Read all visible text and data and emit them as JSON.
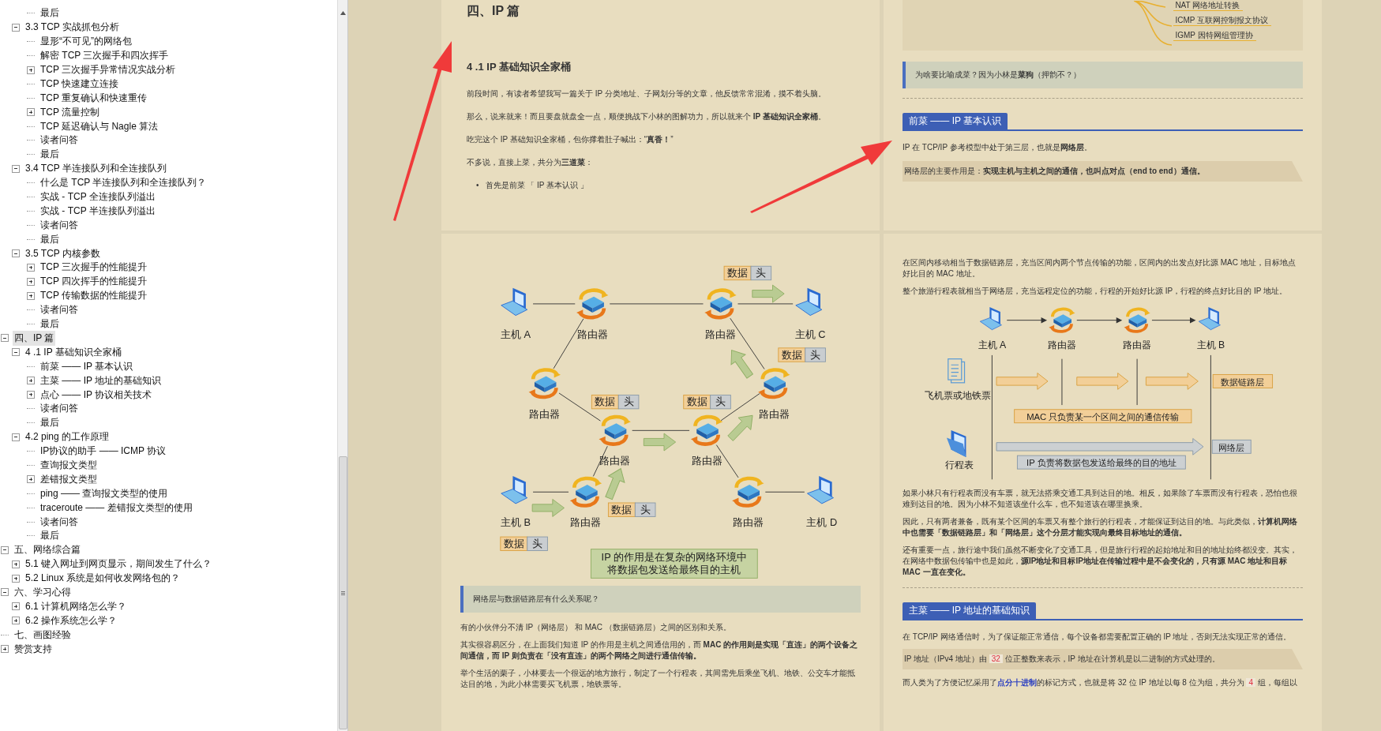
{
  "outline": [
    {
      "children": [
        {
          "children": [
            {
              "label": "最后",
              "selected": false
            }
          ]
        },
        {
          "label": "3.3 TCP 实战抓包分析",
          "expanded": true,
          "selected": false,
          "children": [
            {
              "label": "显形“不可见”的网络包",
              "selected": false
            },
            {
              "label": "解密 TCP 三次握手和四次挥手",
              "selected": false
            },
            {
              "label": "TCP 三次握手异常情况实战分析",
              "expanded": false,
              "selected": false
            },
            {
              "label": "TCP 快速建立连接",
              "selected": false
            },
            {
              "label": "TCP 重复确认和快速重传",
              "selected": false
            },
            {
              "label": "TCP 流量控制",
              "expanded": false,
              "selected": false
            },
            {
              "label": "TCP 延迟确认与 Nagle 算法",
              "selected": false
            },
            {
              "label": "读者问答",
              "selected": false
            },
            {
              "label": "最后",
              "selected": false
            }
          ]
        },
        {
          "label": "3.4 TCP 半连接队列和全连接队列",
          "expanded": true,
          "selected": false,
          "children": [
            {
              "label": "什么是 TCP 半连接队列和全连接队列？",
              "selected": false
            },
            {
              "label": "实战 - TCP 全连接队列溢出",
              "selected": false
            },
            {
              "label": "实战 - TCP 半连接队列溢出",
              "selected": false
            },
            {
              "label": "读者问答",
              "selected": false
            },
            {
              "label": "最后",
              "selected": false
            }
          ]
        },
        {
          "label": "3.5 TCP 内核参数",
          "expanded": true,
          "selected": false,
          "children": [
            {
              "label": "TCP 三次握手的性能提升",
              "expanded": false,
              "selected": false
            },
            {
              "label": "TCP 四次挥手的性能提升",
              "expanded": false,
              "selected": false
            },
            {
              "label": "TCP 传输数据的性能提升",
              "expanded": false,
              "selected": false
            },
            {
              "label": "读者问答",
              "selected": false
            },
            {
              "label": "最后",
              "selected": false
            }
          ]
        }
      ]
    },
    {
      "label": "四、IP 篇",
      "expanded": true,
      "selected": true,
      "children": [
        {
          "label": "4 .1 IP 基础知识全家桶",
          "expanded": true,
          "selected": false,
          "children": [
            {
              "label": "前菜 —— IP 基本认识",
              "selected": false
            },
            {
              "label": "主菜 —— IP 地址的基础知识",
              "expanded": false,
              "selected": false
            },
            {
              "label": "点心 —— IP 协议相关技术",
              "expanded": false,
              "selected": false
            },
            {
              "label": "读者问答",
              "selected": false
            },
            {
              "label": "最后",
              "selected": false
            }
          ]
        },
        {
          "label": "4.2 ping 的工作原理",
          "expanded": true,
          "selected": false,
          "children": [
            {
              "label": "IP协议的助手 —— ICMP 协议",
              "selected": false
            },
            {
              "label": "查询报文类型",
              "selected": false
            },
            {
              "label": "差错报文类型",
              "expanded": false,
              "selected": false
            },
            {
              "label": "ping —— 查询报文类型的使用",
              "selected": false
            },
            {
              "label": "traceroute —— 差错报文类型的使用",
              "selected": false
            },
            {
              "label": "读者问答",
              "selected": false
            },
            {
              "label": "最后",
              "selected": false
            }
          ]
        }
      ]
    },
    {
      "label": "五、网络综合篇",
      "expanded": true,
      "selected": false,
      "children": [
        {
          "label": "5.1 键入网址到网页显示，期间发生了什么？",
          "expanded": false,
          "selected": false
        },
        {
          "label": "5.2 Linux 系统是如何收发网络包的？",
          "expanded": false,
          "selected": false
        }
      ]
    },
    {
      "label": "六、学习心得",
      "expanded": true,
      "selected": false,
      "children": [
        {
          "label": "6.1 计算机网络怎么学？",
          "expanded": false,
          "selected": false
        },
        {
          "label": "6.2 操作系统怎么学？",
          "expanded": false,
          "selected": false
        }
      ]
    },
    {
      "label": "七、画图经验",
      "selected": false
    },
    {
      "label": "赞赏支持",
      "expanded": false,
      "selected": false
    }
  ],
  "pages": {
    "chapter_page": {
      "title": "四、IP 篇",
      "heading": "4 .1 IP 基础知识全家桶",
      "paragraphs": [
        "前段时间，有读者希望我写一篇关于 IP 分类地址、子网划分等的文章，他反馈常常混淆，摸不着头脑。",
        "那么，说来就来！而且要盘就盘全一点，顺便挑战下小林的图解功力，所以就来个 **IP 基础知识全家桶**。",
        "吃完这个 IP 基础知识全家桶，包你撑着肚子喊出：“**真香！**”",
        "不多说，直接上菜，共分为**三道菜**："
      ],
      "bullets": [
        {
          "marker": "•",
          "text": "首先是前菜 「 IP 基本认识 」"
        }
      ]
    },
    "intro_page": {
      "mind_map_branches": [
        "NAT 网络地址转换",
        "ICMP 互联网控制报文协议",
        "IGMP 因特网组管理协"
      ],
      "quote": "为啥要比喻成菜？因为小林是**菜狗**（押韵不？）",
      "section_heading": "前菜 —— IP 基本认识",
      "paragraphs": [
        "IP 在 TCP/IP 参考模型中处于第三层，也就是**网络层**。"
      ],
      "callout": "网络层的主要作用是：**实现主机与主机之间的通信，也叫点对点（end to end）通信。**"
    },
    "network_page": {
      "diagram": {
        "nodes": [
          {
            "kind": "host",
            "label": "主机 A"
          },
          {
            "kind": "router",
            "label": "路由器"
          },
          {
            "kind": "router",
            "label": "路由器"
          },
          {
            "kind": "host",
            "label": "主机 C"
          },
          {
            "kind": "router",
            "label": "路由器"
          },
          {
            "kind": "router",
            "label": "路由器"
          },
          {
            "kind": "router",
            "label": "路由器"
          },
          {
            "kind": "router",
            "label": "路由器"
          },
          {
            "kind": "host",
            "label": "主机 B"
          },
          {
            "kind": "router",
            "label": "路由器"
          },
          {
            "kind": "router",
            "label": "路由器"
          },
          {
            "kind": "host",
            "label": "主机 D"
          }
        ],
        "packets": [
          {
            "data": "数据",
            "header": "头"
          },
          {
            "data": "数据",
            "header": "头"
          },
          {
            "data": "数据",
            "header": "头"
          },
          {
            "data": "数据",
            "header": "头"
          },
          {
            "data": "数据",
            "header": "头"
          },
          {
            "data": "数据",
            "header": "头"
          }
        ],
        "caption": [
          "IP 的作用是在复杂的网络环境中",
          "将数据包发送给最终目的主机"
        ]
      },
      "quote": "网络层与数据链路层有什么关系呢？",
      "paragraphs": [
        "有的小伙伴分不清 IP（网络层） 和 MAC （数据链路层）之间的区别和关系。",
        "其实很容易区分，在上面我们知道 IP 的作用是主机之间通信用的，而 **MAC 的作用则是实现「直连」的两个设备之间通信，而 IP 则负责在「没有直连」的两个网络之间进行通信传输。**",
        "举个生活的栗子，小林要去一个很远的地方旅行，制定了一个行程表，其间需先后乘坐飞机、地铁、公交车才能抵达目的地，为此小林需要买飞机票，地铁票等。"
      ]
    },
    "layers_page": {
      "paragraphs_before": [
        "在区间内移动相当于数据链路层，充当区间内两个节点传输的功能，区间内的出发点好比源 MAC 地址，目标地点好比目的 MAC 地址。",
        "整个旅游行程表就相当于网络层，充当远程定位的功能，行程的开始好比源 IP，行程的终点好比目的 IP 地址。"
      ],
      "diagram": {
        "nodes": [
          {
            "kind": "host",
            "label": "主机 A"
          },
          {
            "kind": "router",
            "label": "路由器"
          },
          {
            "kind": "router",
            "label": "路由器"
          },
          {
            "kind": "host",
            "label": "主机 B"
          }
        ],
        "items": [
          {
            "kind": "ticket",
            "label": "飞机票或地铁票"
          },
          {
            "kind": "itinerary",
            "label": "行程表"
          }
        ],
        "layers": [
          {
            "kind": "data_link",
            "name": "数据链路层",
            "note": "MAC 只负责某一个区间之间的通信传输"
          },
          {
            "kind": "network",
            "name": "网络层",
            "note": "IP 负责将数据包发送给最终的目的地址"
          }
        ]
      },
      "paragraphs_after": [
        "如果小林只有行程表而没有车票，就无法搭乘交通工具到达目的地。相反，如果除了车票而没有行程表，恐怕也很难到达目的地。因为小林不知道该坐什么车，也不知道该在哪里换乘。",
        "因此，只有两者兼备，既有某个区间的车票又有整个旅行的行程表，才能保证到达目的地。与此类似，**计算机网络中也需要「数据链路层」和「网络层」这个分层才能实现向最终目标地址的通信。**",
        "还有重要一点，旅行途中我们虽然不断变化了交通工具，但是旅行行程的起始地址和目的地址始终都没变。其实，在网络中数据包传输中也是如此，**源IP地址和目标IP地址在传输过程中是不会变化的，只有源 MAC 地址和目标 MAC 一直在变化。**"
      ],
      "section_heading": "主菜 —— IP 地址的基础知识",
      "section_paragraph": "在 TCP/IP 网络通信时，为了保证能正常通信，每个设备都需要配置正确的 IP 地址，否则无法实现正常的通信。",
      "callout_parts": [
        {
          "text": "IP 地址（IPv4 地址）由 "
        },
        {
          "text": "32",
          "kind": "number"
        },
        {
          "text": " 位正整数来表示，IP 地址在计算机是以二进制的方式处理的。"
        }
      ],
      "last_parts": [
        {
          "text": "而人类为了方便记忆采用了"
        },
        {
          "text": "点分十进制",
          "kind": "link"
        },
        {
          "text": "的标记方式，也就是将 32 位 IP 地址以每 8 位为组，共分为 "
        },
        {
          "text": "4",
          "kind": "number"
        },
        {
          "text": " 组，每组以"
        }
      ]
    }
  }
}
